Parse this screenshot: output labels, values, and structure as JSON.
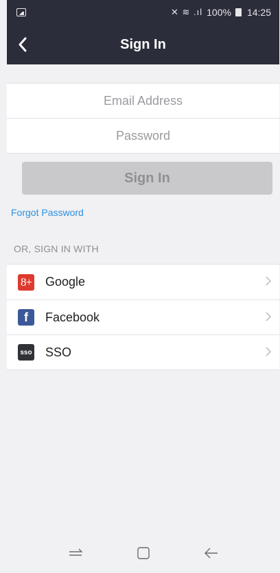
{
  "status": {
    "signal_text": "100%",
    "time": "14:25"
  },
  "header": {
    "title": "Sign In"
  },
  "form": {
    "email_placeholder": "Email Address",
    "email_value": "",
    "password_placeholder": "Password",
    "password_value": "",
    "signin_label": "Sign In",
    "forgot_label": "Forgot Password"
  },
  "alt_signin": {
    "section_label": "OR, SIGN IN WITH",
    "providers": [
      {
        "label": "Google",
        "icon": "google-plus-icon",
        "icon_text": "8+",
        "color": "#dd3b2f"
      },
      {
        "label": "Facebook",
        "icon": "facebook-icon",
        "icon_text": "f",
        "color": "#3b5998"
      },
      {
        "label": "SSO",
        "icon": "sso-icon",
        "icon_text": "sso",
        "color": "#2f3236"
      }
    ]
  },
  "colors": {
    "header_bg": "#2b2d3a",
    "link": "#2a8fe0",
    "disabled_button": "#c9c9cc"
  }
}
